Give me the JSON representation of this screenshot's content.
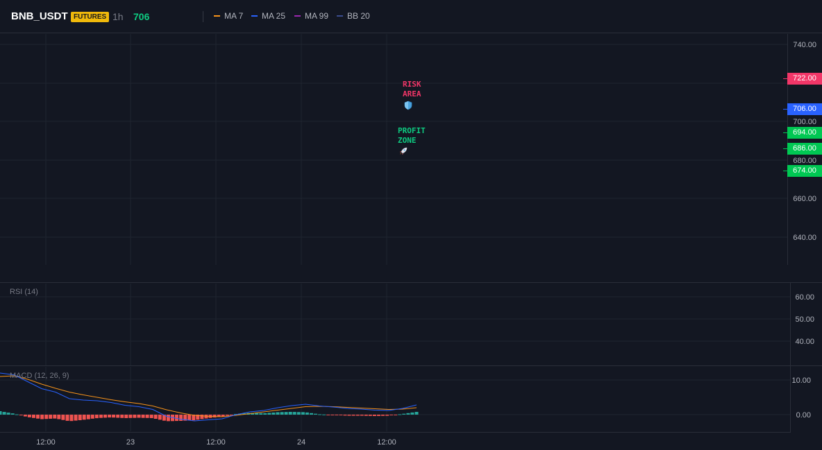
{
  "header": {
    "symbol": "BNB_USDT",
    "badge": "FUTURES",
    "timeframe": "1h",
    "last_price": "706",
    "legend": [
      {
        "label": "MA 7",
        "color": "#f7931a"
      },
      {
        "label": "MA 25",
        "color": "#2962ff"
      },
      {
        "label": "MA 99",
        "color": "#9c27b0"
      },
      {
        "label": "BB 20",
        "color": "#3b4d8f"
      }
    ]
  },
  "price_axis": {
    "ticks": [
      "740.00",
      "700.00",
      "680.00",
      "660.00",
      "640.00"
    ]
  },
  "price_tags": [
    {
      "label": "722.00",
      "color": "#f23668",
      "value": 722
    },
    {
      "label": "706.00",
      "color": "#2962ff",
      "value": 706
    },
    {
      "label": "694.00",
      "color": "#00c853",
      "value": 694
    },
    {
      "label": "686.00",
      "color": "#00c853",
      "value": 686
    },
    {
      "label": "674.00",
      "color": "#00c853",
      "value": 674
    }
  ],
  "annotations": {
    "risk": {
      "text": "RISK\nAREA",
      "icon": "shield-icon",
      "color": "#f23668"
    },
    "profit": {
      "text": "PROFIT\nZONE",
      "icon": "rocket-icon",
      "color": "#0ecb81"
    }
  },
  "rsi": {
    "title": "RSI (14)",
    "ticks": [
      "60.00",
      "50.00",
      "40.00"
    ]
  },
  "macd": {
    "title": "MACD (12, 26, 9)",
    "ticks": [
      "10.00",
      "0.00"
    ],
    "macd_line": [
      12,
      11.5,
      9.5,
      7.5,
      6.5,
      4.6,
      4.2,
      4,
      3.5,
      2.7,
      2.3,
      1.5,
      -0.5,
      -1.3,
      -1.8,
      -1.5,
      -1.2,
      0,
      0.8,
      1.2,
      2,
      2.6,
      3,
      2.5,
      2.2,
      1.8,
      1.6,
      1.3,
      1.2,
      1.8,
      2.8
    ],
    "signal_line": [
      11,
      11.2,
      10.2,
      8.8,
      7.6,
      6.5,
      5.7,
      5,
      4.3,
      3.7,
      3.2,
      2.5,
      1.4,
      0.5,
      -0.2,
      -0.5,
      -0.6,
      -0.2,
      0.3,
      0.8,
      1.3,
      1.8,
      2.3,
      2.4,
      2.3,
      2.1,
      1.9,
      1.7,
      1.5,
      1.6,
      2
    ]
  },
  "time_axis": {
    "ticks": [
      "12:00",
      "23",
      "12:00",
      "24",
      "12:00"
    ]
  }
}
